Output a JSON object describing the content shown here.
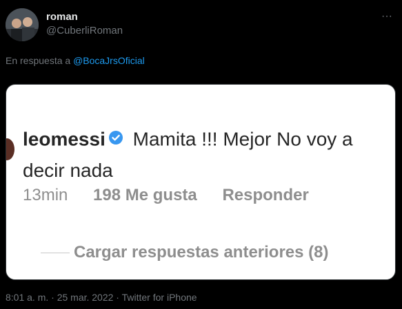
{
  "author": {
    "display_name": "roman",
    "handle": "@CuberliRoman"
  },
  "menu_icon": "more-horizontal-icon",
  "reply_context": {
    "prefix": "En respuesta a ",
    "mention": "@BocaJrsOficial"
  },
  "embedded_image": {
    "username": "leomessi",
    "comment_text": " Mamita !!! Mejor No voy a decir nada",
    "time": "13min",
    "likes": "198 Me gusta",
    "reply_label": "Responder",
    "load_more": "Cargar respuestas anteriores (8)",
    "verified_color": "#3897f0"
  },
  "footer": {
    "timestamp": "8:01 a. m. · 25 mar. 2022 · Twitter for iPhone"
  },
  "colors": {
    "background": "#000000",
    "link": "#1d9bf0",
    "muted": "#71767b"
  }
}
